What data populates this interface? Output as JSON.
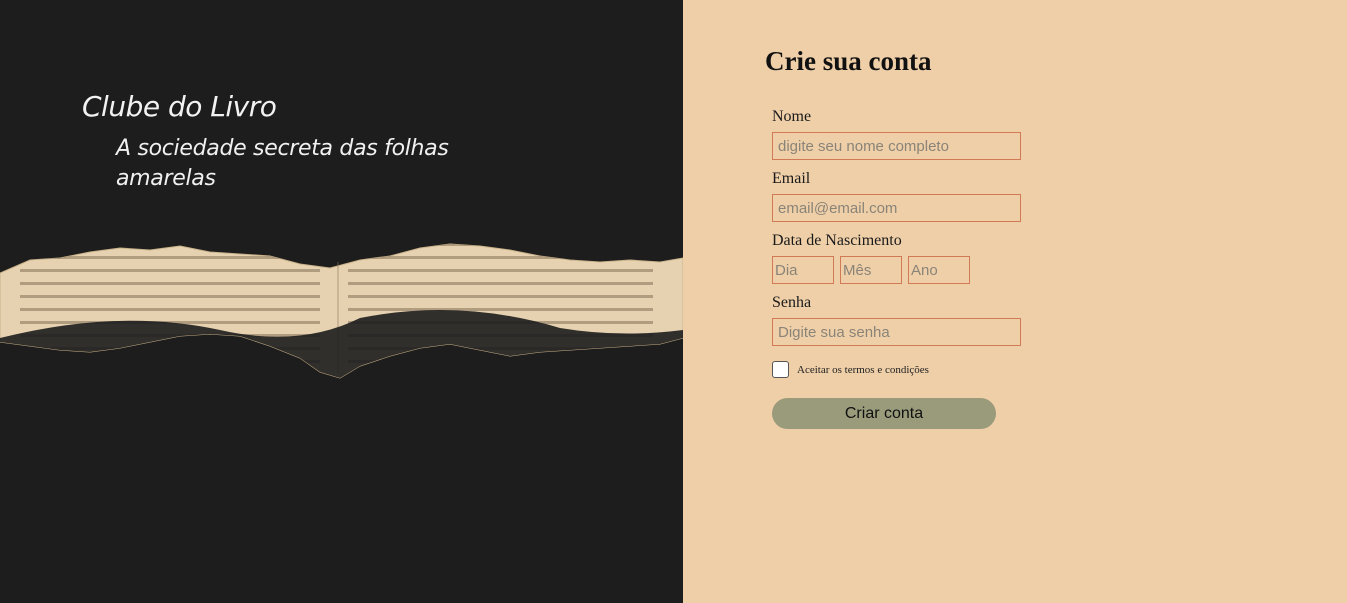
{
  "brand": {
    "title": "Clube do Livro",
    "tagline": "A sociedade secreta das folhas amarelas"
  },
  "form": {
    "heading": "Crie sua conta",
    "name": {
      "label": "Nome",
      "placeholder": "digite seu nome completo"
    },
    "email": {
      "label": "Email",
      "placeholder": "email@email.com"
    },
    "birthdate": {
      "label": "Data de Nascimento",
      "day_placeholder": "Dia",
      "month_placeholder": "Mês",
      "year_placeholder": "Ano"
    },
    "password": {
      "label": "Senha",
      "placeholder": "Digite sua senha"
    },
    "terms_label": "Aceitar os termos e condições",
    "submit_label": "Criar conta"
  },
  "colors": {
    "left_bg": "#1d1d1d",
    "right_bg": "#efcfa8",
    "input_border": "#d07b56",
    "button_bg": "#9a9b7b",
    "paper": "#e6d2b0"
  }
}
